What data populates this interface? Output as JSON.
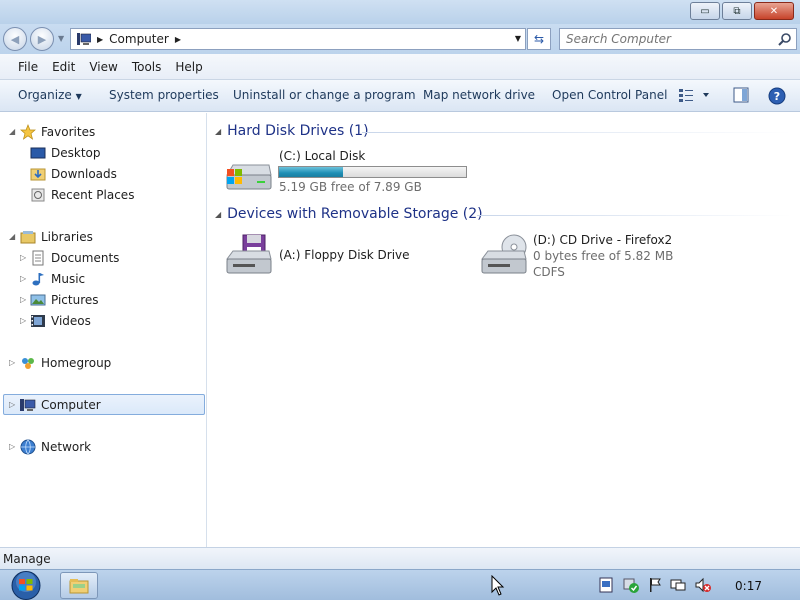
{
  "window": {
    "title_buttons": {
      "minimize": "▭",
      "maximize": "⧉",
      "close": "✕"
    }
  },
  "address": {
    "crumb": "Computer",
    "search_placeholder": "Search Computer"
  },
  "menu": [
    "File",
    "Edit",
    "View",
    "Tools",
    "Help"
  ],
  "commands": {
    "organize": "Organize",
    "system_properties": "System properties",
    "uninstall": "Uninstall or change a program",
    "map_drive": "Map network drive",
    "control_panel": "Open Control Panel"
  },
  "nav": {
    "favorites": "Favorites",
    "desktop": "Desktop",
    "downloads": "Downloads",
    "recent": "Recent Places",
    "libraries": "Libraries",
    "documents": "Documents",
    "music": "Music",
    "pictures": "Pictures",
    "videos": "Videos",
    "homegroup": "Homegroup",
    "computer": "Computer",
    "network": "Network"
  },
  "groups": {
    "hdd": "Hard Disk Drives (1)",
    "removable": "Devices with Removable Storage (2)"
  },
  "drives": {
    "c": {
      "name": "(C:) Local Disk",
      "free": "5.19 GB free of 7.89 GB",
      "used_fraction": 0.34
    },
    "a": {
      "name": "(A:) Floppy Disk Drive"
    },
    "d": {
      "name": "(D:) CD Drive - Firefox2",
      "free": "0 bytes free of 5.82 MB",
      "fs": "CDFS"
    }
  },
  "status": "Manage",
  "taskbar": {
    "clock": "0:17"
  },
  "colors": {
    "accent": "#1e3287",
    "progress": "#1f8fb5",
    "selection": "#dbe9fa"
  }
}
